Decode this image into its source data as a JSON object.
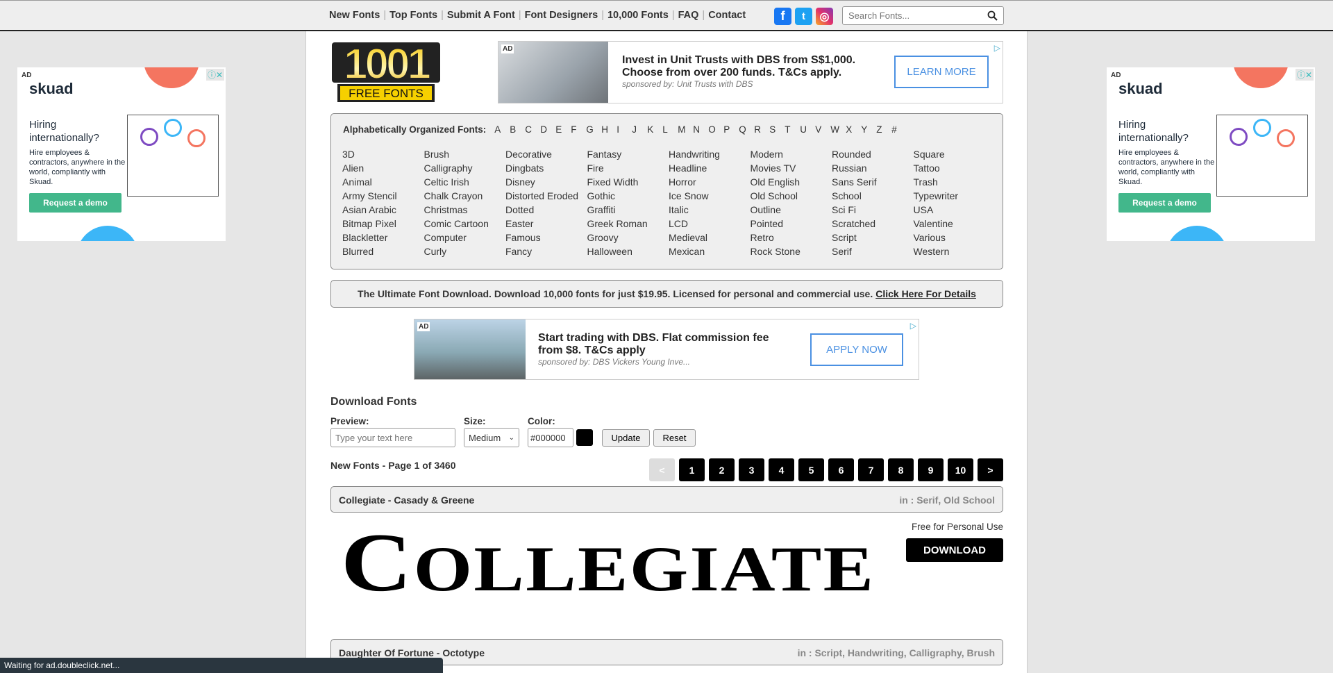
{
  "nav": {
    "items": [
      "New Fonts",
      "Top Fonts",
      "Submit A Font",
      "Font Designers",
      "10,000 Fonts",
      "FAQ",
      "Contact"
    ]
  },
  "social": [
    {
      "icon": "facebook-icon",
      "color": "#1877f2",
      "glyph": "f"
    },
    {
      "icon": "twitter-icon",
      "color": "#1da1f2",
      "glyph": "t"
    },
    {
      "icon": "instagram-icon",
      "color": "#c13584",
      "glyph": "◎"
    }
  ],
  "search": {
    "placeholder": "Search Fonts..."
  },
  "logo": {
    "top": "1001",
    "bottom": "FREE FONTS"
  },
  "side_ad": {
    "tag": "AD",
    "brand": "skuad",
    "headline": "Hiring internationally?",
    "body": "Hire employees & contractors, anywhere in the world, compliantly with Skuad.",
    "cta": "Request a demo"
  },
  "top_ad": {
    "tag": "AD",
    "headline": "Invest in Unit Trusts with DBS from S$1,000. Choose from over 200 funds. T&Cs apply.",
    "sponsor": "sponsored by: Unit Trusts with DBS",
    "cta": "LEARN MORE"
  },
  "categories": {
    "label": "Alphabetically Organized Fonts:",
    "letters": [
      "A",
      "B",
      "C",
      "D",
      "E",
      "F",
      "G",
      "H",
      "I",
      "J",
      "K",
      "L",
      "M",
      "N",
      "O",
      "P",
      "Q",
      "R",
      "S",
      "T",
      "U",
      "V",
      "W",
      "X",
      "Y",
      "Z",
      "#"
    ],
    "items": [
      "3D",
      "Alien",
      "Animal",
      "Army Stencil",
      "Asian Arabic",
      "Bitmap Pixel",
      "Blackletter",
      "Blurred",
      "Brush",
      "Calligraphy",
      "Celtic Irish",
      "Chalk Crayon",
      "Christmas",
      "Comic Cartoon",
      "Computer",
      "Curly",
      "Decorative",
      "Dingbats",
      "Disney",
      "Distorted Eroded",
      "Dotted",
      "Easter",
      "Famous",
      "Fancy",
      "Fantasy",
      "Fire",
      "Fixed Width",
      "Gothic",
      "Graffiti",
      "Greek Roman",
      "Groovy",
      "Halloween",
      "Handwriting",
      "Headline",
      "Horror",
      "Ice Snow",
      "Italic",
      "LCD",
      "Medieval",
      "Mexican",
      "Modern",
      "Movies TV",
      "Old English",
      "Old School",
      "Outline",
      "Pointed",
      "Retro",
      "Rock Stone",
      "Rounded",
      "Russian",
      "Sans Serif",
      "School",
      "Sci Fi",
      "Scratched",
      "Script",
      "Serif",
      "Square",
      "Tattoo",
      "Trash",
      "Typewriter",
      "USA",
      "Valentine",
      "Various",
      "Western"
    ]
  },
  "promo": {
    "text": "The Ultimate Font Download. Download 10,000 fonts for just $19.95. Licensed for personal and commercial use.",
    "link": "Click Here For Details"
  },
  "mid_ad": {
    "tag": "AD",
    "headline": "Start trading with DBS. Flat commission fee from $8. T&Cs apply",
    "sponsor": "sponsored by: DBS Vickers Young Inve...",
    "cta": "APPLY NOW"
  },
  "download": {
    "heading": "Download Fonts",
    "preview_label": "Preview:",
    "preview_placeholder": "Type your text here",
    "size_label": "Size:",
    "size_value": "Medium",
    "color_label": "Color:",
    "color_value": "#000000",
    "update": "Update",
    "reset": "Reset"
  },
  "listing": {
    "title": "New Fonts - Page 1 of 3460",
    "pages": [
      "<",
      "1",
      "2",
      "3",
      "4",
      "5",
      "6",
      "7",
      "8",
      "9",
      "10",
      ">"
    ]
  },
  "fonts": [
    {
      "name": "Collegiate - Casady & Greene",
      "in_label": "in :",
      "categories": "Serif, Old School",
      "preview_first": "C",
      "preview_rest": "OLLEGIATE",
      "license": "Free for Personal Use",
      "download": "DOWNLOAD"
    },
    {
      "name": "Daughter Of Fortune - Octotype",
      "in_label": "in :",
      "categories": "Script, Handwriting, Calligraphy, Brush"
    }
  ],
  "status": "Waiting for ad.doubleclick.net..."
}
